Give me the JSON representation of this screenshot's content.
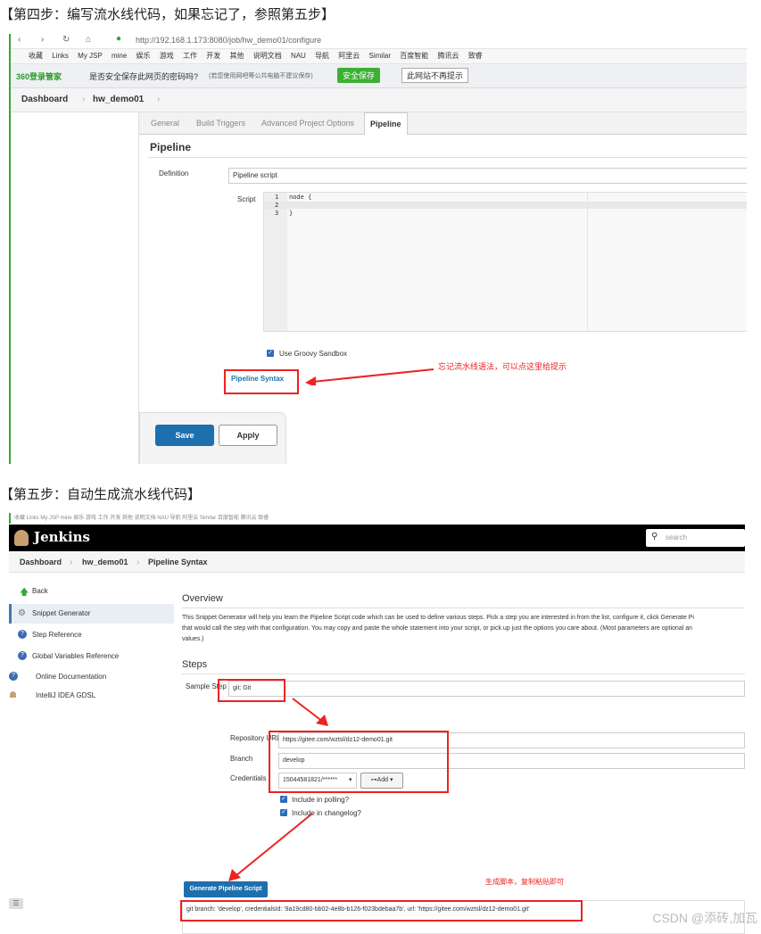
{
  "step4": {
    "heading": "【第四步：编写流水线代码，如果忘记了，参照第五步】",
    "url": "http://192.168.1.173:8080/job/hw_demo01/configure",
    "bookmarks": [
      "收藏",
      "Links",
      "My JSP",
      "mine",
      "娱乐",
      "游戏",
      "工作",
      "开发",
      "其他",
      "说明文档",
      "NAU",
      "导航",
      "阿里云",
      "Similar",
      "百度智能",
      "腾讯云",
      "致睿"
    ],
    "password_bar": {
      "brand": "360登录管家",
      "question": "是否安全保存此网页的密码吗?",
      "hint": "(若您使用网吧等公共电脑不建议保存)",
      "save_btn": "安全保存",
      "never_btn": "此网站不再提示"
    },
    "breadcrumb": [
      "Dashboard",
      "hw_demo01"
    ],
    "tabs": [
      "General",
      "Build Triggers",
      "Advanced Project Options",
      "Pipeline"
    ],
    "section_title": "Pipeline",
    "definition_label": "Definition",
    "definition_value": "Pipeline script",
    "script_label": "Script",
    "code_lines": [
      {
        "num": "1",
        "text": "node {"
      },
      {
        "num": "2",
        "text": ""
      },
      {
        "num": "3",
        "text": "}"
      }
    ],
    "sandbox_label": "Use Groovy Sandbox",
    "syntax_link": "Pipeline Syntax",
    "annotation": "忘记流水线语法，可以点这里给提示",
    "save_label": "Save",
    "apply_label": "Apply"
  },
  "step5": {
    "heading": "【第五步：自动生成流水线代码】",
    "bookmarks_faint": "收藏  Links  My JSP  mine  娱乐  游戏  工作  开发  其他  说明文档  NAU  导航  阿里云  Similar  百度智能  腾讯云  致睿",
    "app_title": "Jenkins",
    "search_placeholder": "search",
    "breadcrumb": [
      "Dashboard",
      "hw_demo01",
      "Pipeline Syntax"
    ],
    "sidebar": [
      "Back",
      "Snippet Generator",
      "Step Reference",
      "Global Variables Reference",
      "Online Documentation",
      "IntelliJ IDEA GDSL"
    ],
    "overview_title": "Overview",
    "overview_text_1": "This Snippet Generator will help you learn the Pipeline Script code which can be used to define various steps. Pick a step you are interested in from the list, configure it, click Generate Pi",
    "overview_text_2": "that would call the step with that configuration. You may copy and paste the whole statement into your script, or pick up just the options you care about. (Most parameters are optional an",
    "overview_text_3": "values.)",
    "steps_title": "Steps",
    "sample_step_label": "Sample Step",
    "sample_step_value": "git: Git",
    "repo_label": "Repository URL",
    "repo_value": "https://gitee.com/wztsl/dz12-demo01.git",
    "branch_label": "Branch",
    "branch_value": "develop",
    "cred_label": "Credentials",
    "cred_value": "15044581821/******",
    "add_label": "Add",
    "polling_label": "Include in polling?",
    "changelog_label": "Include in changelog?",
    "annotation": "生成脚本，复制粘贴即可",
    "generate_label": "Generate Pipeline Script",
    "generated": "git branch: 'develop', credentialsId: '9a19cd80-bb02-4e8b-b126-f023bdebaa7b', url: 'https://gitee.com/wztsl/dz12-demo01.git'"
  },
  "watermark": "CSDN @添砖,加瓦"
}
